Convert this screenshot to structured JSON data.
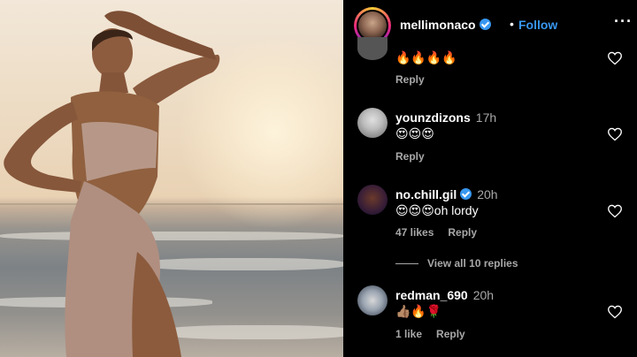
{
  "header": {
    "username": "mellimonaco",
    "separator": "•",
    "follow_label": "Follow",
    "more_label": "···"
  },
  "comments": [
    {
      "username": "",
      "time": "",
      "text": "🔥🔥🔥🔥",
      "likes": "",
      "reply_label": "Reply"
    },
    {
      "username": "younzdizons",
      "time": "17h",
      "text": "😍😍😍",
      "likes": "",
      "reply_label": "Reply"
    },
    {
      "username": "no.chill.gil",
      "time": "20h",
      "verified": true,
      "text": "😍😍😍oh lordy",
      "likes": "47 likes",
      "reply_label": "Reply"
    },
    {
      "username": "redman_690",
      "time": "20h",
      "text": "👍🏽🔥🌹",
      "likes": "1 like",
      "reply_label": "Reply"
    }
  ],
  "view_replies": "View all 10 replies",
  "colors": {
    "accent": "#3897f0",
    "background": "#000000",
    "muted_text": "#a8a8a8"
  },
  "icons": [
    "verified-badge-icon",
    "heart-icon",
    "more-options-icon"
  ]
}
